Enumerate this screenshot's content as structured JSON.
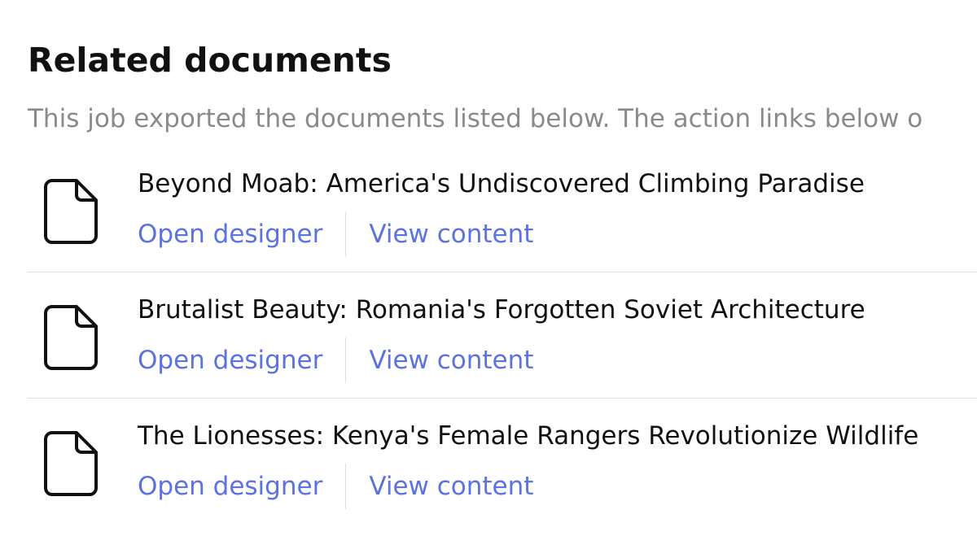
{
  "section": {
    "title": "Related documents",
    "description": "This job exported the documents listed below. The action links below o"
  },
  "icons": {
    "document": "document-icon"
  },
  "colors": {
    "link": "#5b72e0",
    "description": "#8a8a8a",
    "divider": "#dedede"
  },
  "documents": [
    {
      "title": "Beyond Moab: America's Undiscovered Climbing Paradise",
      "open_designer": "Open designer",
      "view_content": "View content"
    },
    {
      "title": "Brutalist Beauty: Romania's Forgotten Soviet Architecture",
      "open_designer": "Open designer",
      "view_content": "View content"
    },
    {
      "title": "The Lionesses: Kenya's Female Rangers Revolutionize Wildlife",
      "open_designer": "Open designer",
      "view_content": "View content"
    }
  ]
}
